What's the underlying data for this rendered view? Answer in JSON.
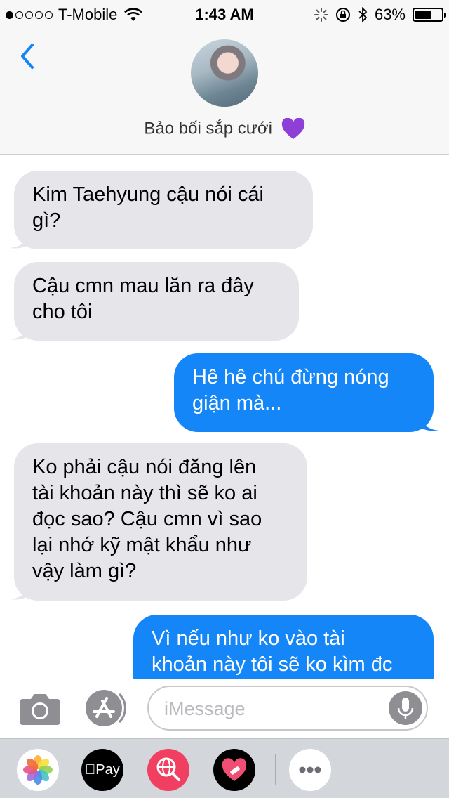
{
  "status": {
    "carrier": "T-Mobile",
    "time": "1:43 AM",
    "battery": "63%",
    "battery_level": 0.63,
    "signal_bars": 1
  },
  "header": {
    "back_icon": "chevron-left-icon",
    "contact_name": "Bảo bối sắp cưới",
    "contact_emoji": "purple-heart-icon"
  },
  "messages": [
    {
      "direction": "incoming",
      "lines": [
        "Kim Taehyung cậu nói cái",
        "gì?"
      ]
    },
    {
      "direction": "incoming",
      "lines": [
        "Cậu cmn mau lăn ra đây",
        "cho tôi"
      ]
    },
    {
      "direction": "outgoing",
      "lines": [
        "Hê hê chú đừng nóng",
        "giận mà..."
      ]
    },
    {
      "direction": "incoming",
      "lines": [
        "Ko phải cậu nói đăng lên",
        "tài khoản này thì sẽ ko ai",
        "đọc sao? Cậu cmn vì sao",
        "lại nhớ kỹ mật khẩu như",
        "vậy làm gì?"
      ]
    },
    {
      "direction": "outgoing",
      "lines": [
        "Vì nếu như ko vào tài",
        "khoản này tôi sẽ ko kìm đc"
      ]
    }
  ],
  "composer": {
    "placeholder": "iMessage",
    "camera_icon": "camera-icon",
    "appstore_icon": "app-store-icon",
    "mic_icon": "microphone-icon"
  },
  "drawer": {
    "apps": [
      "photos-app-icon",
      "apple-pay-app-icon",
      "image-search-app-icon",
      "heart-stickers-app-icon",
      "more-apps-icon"
    ],
    "pay_label": "Pay"
  },
  "colors": {
    "accent": "#1486f7",
    "incoming_bubble": "#e5e5ea",
    "outgoing_bubble": "#1486f7",
    "heart": "#8e3fd6"
  }
}
